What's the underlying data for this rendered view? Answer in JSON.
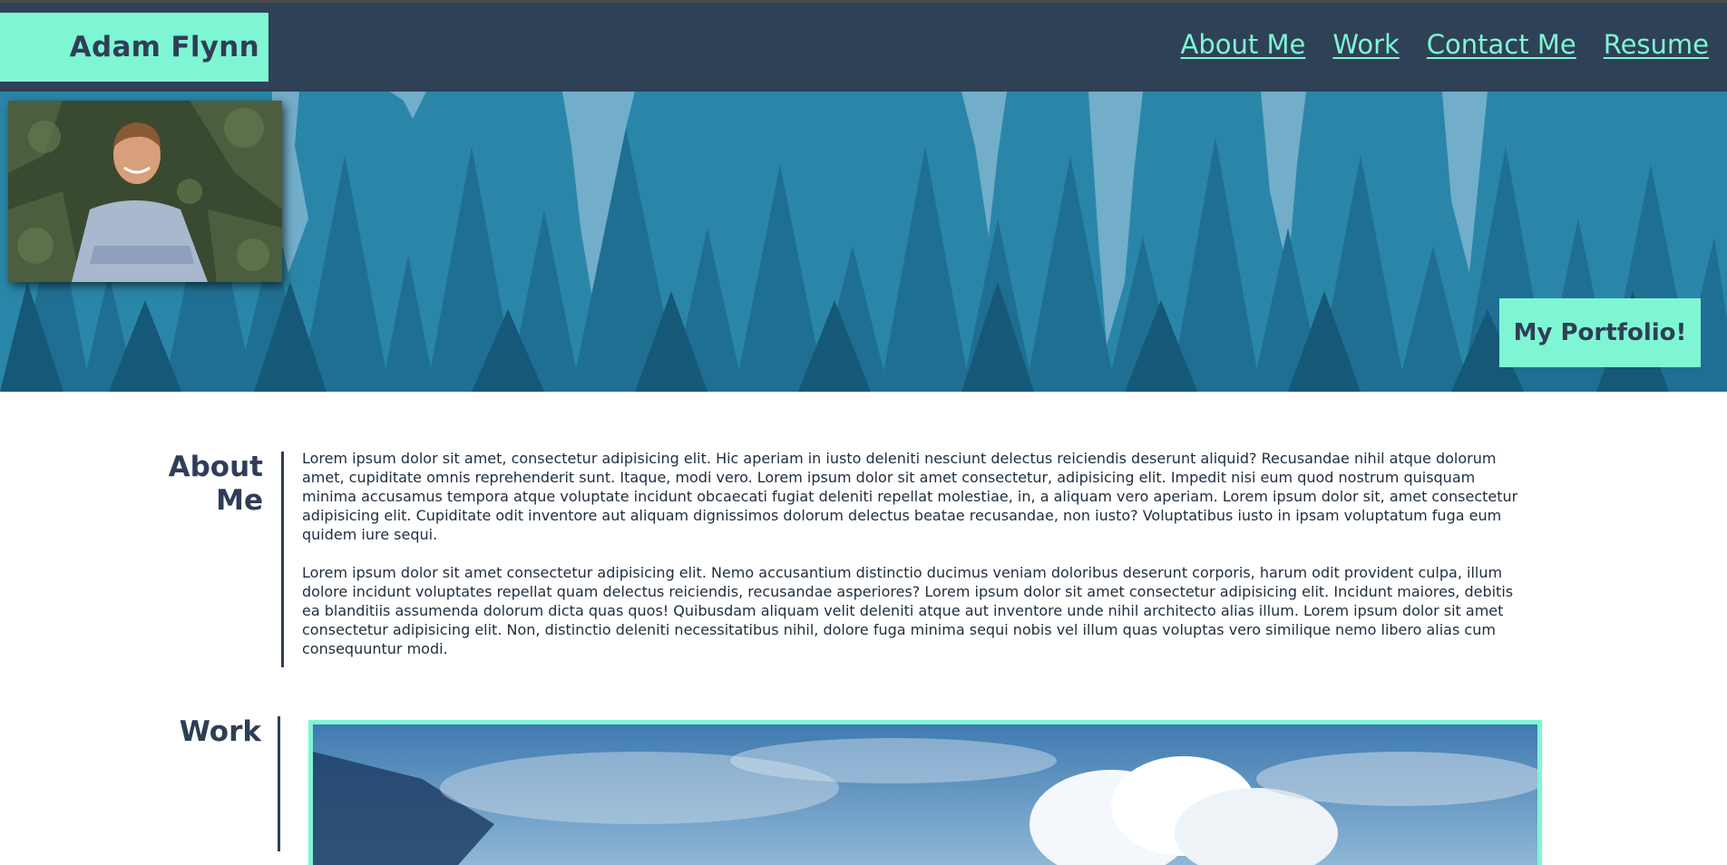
{
  "header": {
    "brand": "Adam Flynn",
    "nav": [
      "About Me",
      "Work",
      "Contact Me",
      "Resume"
    ]
  },
  "hero": {
    "cta_label": "My Portfolio!"
  },
  "about": {
    "title_line1": "About",
    "title_line2": "Me",
    "paragraphs": [
      "Lorem ipsum dolor sit amet, consectetur adipisicing elit. Hic aperiam in iusto deleniti nesciunt delectus reiciendis deserunt aliquid? Recusandae nihil atque dolorum amet, cupiditate omnis reprehenderit sunt. Itaque, modi vero. Lorem ipsum dolor sit amet consectetur, adipisicing elit. Impedit nisi eum quod nostrum quisquam minima accusamus tempora atque voluptate incidunt obcaecati fugiat deleniti repellat molestiae, in, a aliquam vero aperiam. Lorem ipsum dolor sit, amet consectetur adipisicing elit. Cupiditate odit inventore aut aliquam dignissimos dolorum delectus beatae recusandae, non iusto? Voluptatibus iusto in ipsam voluptatum fuga eum quidem iure sequi.",
      "Lorem ipsum dolor sit amet consectetur adipisicing elit. Nemo accusantium distinctio ducimus veniam doloribus deserunt corporis, harum odit provident culpa, illum dolore incidunt voluptates repellat quam delectus reiciendis, recusandae asperiores? Lorem ipsum dolor sit amet consectetur adipisicing elit. Incidunt maiores, debitis ea blanditiis assumenda dolorum dicta quas quos! Quibusdam aliquam velit deleniti atque aut inventore unde nihil architecto alias illum. Lorem ipsum dolor sit amet consectetur adipisicing elit. Non, distinctio deleniti necessitatibus nihil, dolore fuga minima sequi nobis vel illum quas voluptas vero similique nemo libero alias cum consequuntur modi."
    ]
  },
  "work": {
    "title": "Work"
  },
  "colors": {
    "navy": "#2f4157",
    "mint": "#7ff6d3",
    "forest": "#2a86a8"
  }
}
